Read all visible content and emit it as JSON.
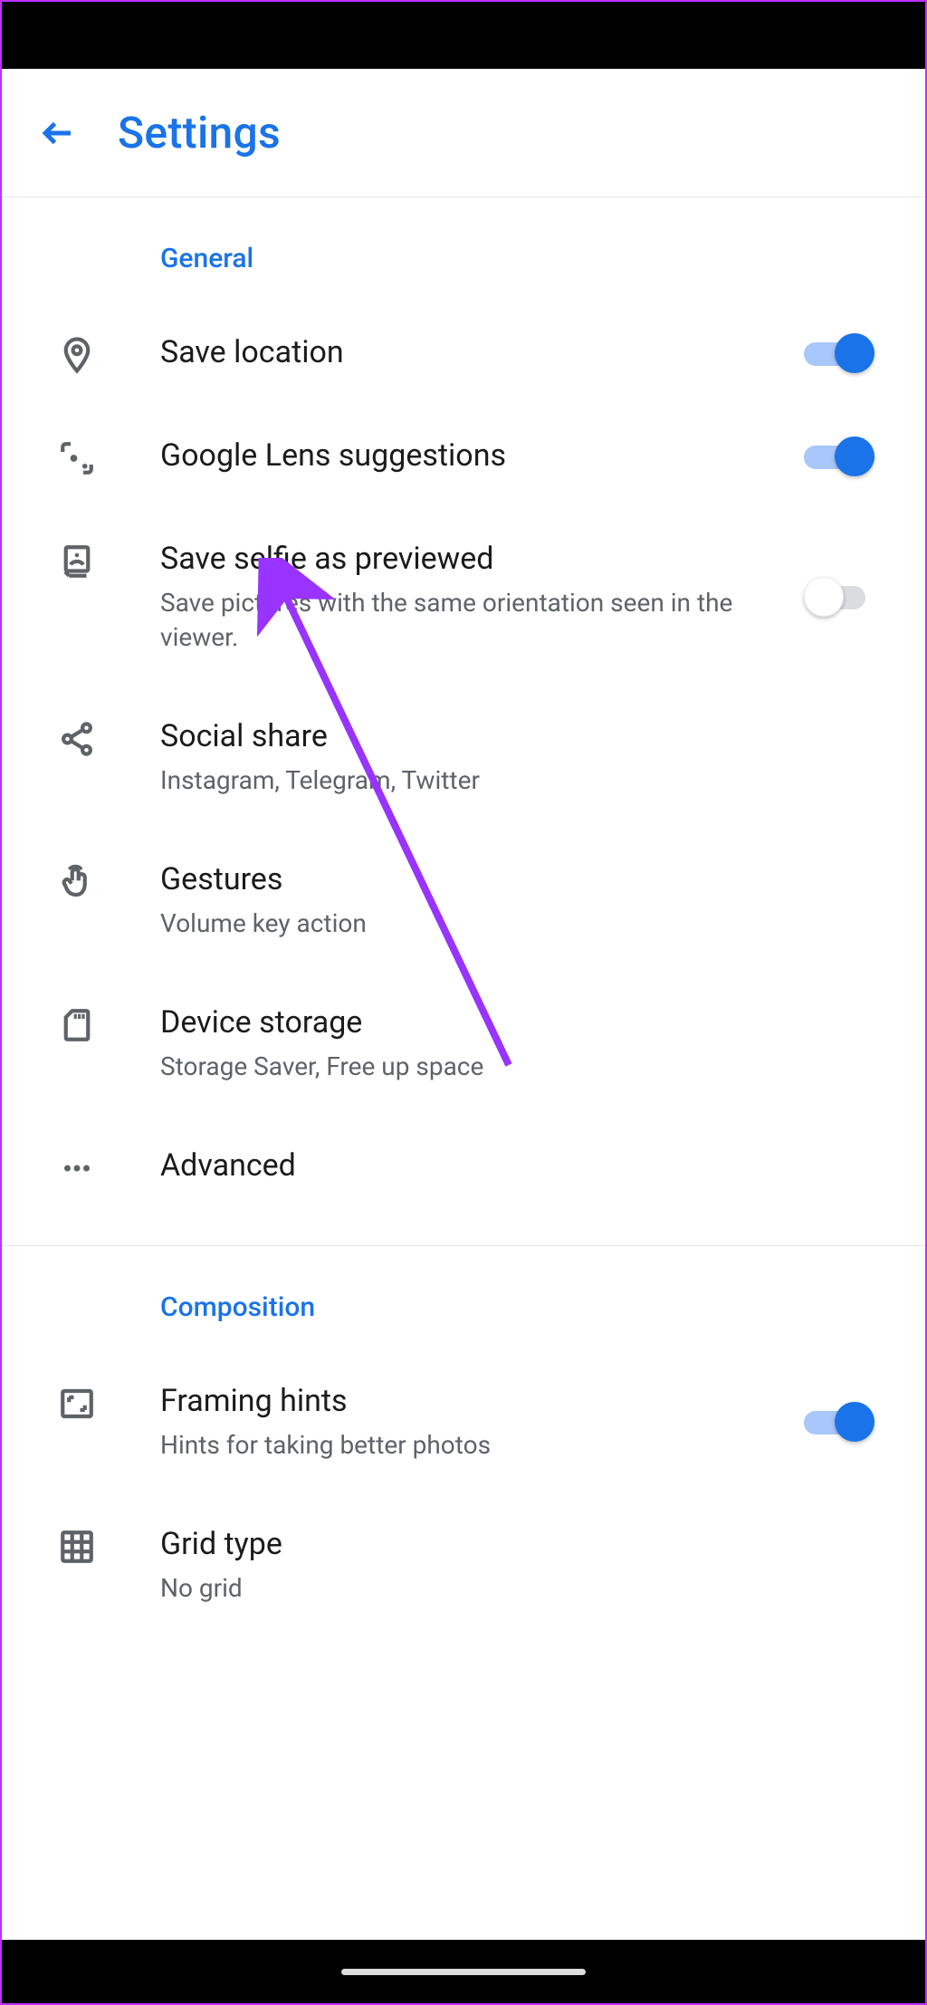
{
  "header": {
    "title": "Settings"
  },
  "sections": {
    "general": {
      "label": "General",
      "save_location": {
        "title": "Save location",
        "toggle": true
      },
      "lens": {
        "title": "Google Lens suggestions",
        "toggle": true
      },
      "selfie": {
        "title": "Save selfie as previewed",
        "subtitle": "Save pictures with the same orientation seen in the viewer.",
        "toggle": false
      },
      "social": {
        "title": "Social share",
        "subtitle": "Instagram, Telegram, Twitter"
      },
      "gestures": {
        "title": "Gestures",
        "subtitle": "Volume key action"
      },
      "storage": {
        "title": "Device storage",
        "subtitle": "Storage Saver, Free up space"
      },
      "advanced": {
        "title": "Advanced"
      }
    },
    "composition": {
      "label": "Composition",
      "framing": {
        "title": "Framing hints",
        "subtitle": "Hints for taking better photos",
        "toggle": true
      },
      "grid": {
        "title": "Grid type",
        "subtitle": "No grid"
      }
    }
  },
  "annotation": {
    "color": "#9933ff"
  }
}
